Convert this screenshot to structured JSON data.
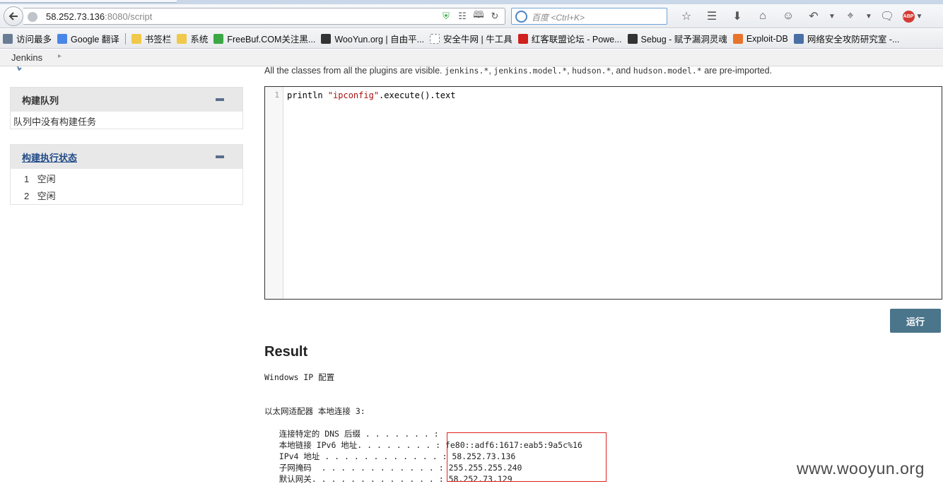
{
  "browser": {
    "url_host": "58.252.73.136",
    "url_path": ":8080/script",
    "search_placeholder": "百度 <Ctrl+K>",
    "abp_label": "ABP",
    "bookmarks": [
      {
        "label": "访问最多",
        "icon": "gear-icon",
        "color": "#6a7c94"
      },
      {
        "label": "Google 翻译",
        "icon": "google-translate-icon",
        "color": "#4a86e8"
      },
      {
        "label": "书签栏",
        "icon": "folder-icon",
        "color": "#f0c94b"
      },
      {
        "label": "系统",
        "icon": "folder-icon",
        "color": "#f0c94b"
      },
      {
        "label": "FreeBuf.COM关注黑...",
        "icon": "freebuf-icon",
        "color": "#3aa845"
      },
      {
        "label": "WooYun.org | 自由平...",
        "icon": "wooyun-icon",
        "color": "#333333"
      },
      {
        "label": "安全牛网 | 牛工具",
        "icon": "page-icon",
        "color": "#ffffff"
      },
      {
        "label": "红客联盟论坛 - Powe...",
        "icon": "hkm-icon",
        "color": "#d02020"
      },
      {
        "label": "Sebug - 赋予漏洞灵魂",
        "icon": "sebug-icon",
        "color": "#333333"
      },
      {
        "label": "Exploit-DB",
        "icon": "exploitdb-icon",
        "color": "#e8732a"
      },
      {
        "label": "网络安全攻防研究室 -...",
        "icon": "shield-icon",
        "color": "#4a6fa5"
      }
    ]
  },
  "jenkins": {
    "breadcrumb": "Jenkins",
    "queue": {
      "title": "构建队列",
      "empty_text": "队列中没有构建任务"
    },
    "executors": {
      "title": "构建执行状态",
      "rows": [
        {
          "num": "1",
          "status": "空闲"
        },
        {
          "num": "2",
          "status": "空闲"
        }
      ]
    },
    "description": {
      "prefix": "All the classes from all the plugins are visible.",
      "pkg1": "jenkins.*",
      "pkg2": "jenkins.model.*",
      "pkg3": "hudson.*",
      "and": "and",
      "pkg4": "hudson.model.*",
      "suffix": "are pre-imported."
    },
    "editor": {
      "line_number": "1",
      "code_prefix": "println ",
      "code_string": "\"ipconfig\"",
      "code_suffix": ".execute().text"
    },
    "run_button": "运行",
    "result_title": "Result",
    "result_output": "Windows IP 配置\n\n\n以太网适配器 本地连接 3:\n\n   连接特定的 DNS 后缀 . . . . . . . :\n   本地链接 IPv6 地址. . . . . . . . : fe80::adf6:1617:eab5:9a5c%16\n   IPv4 地址 . . . . . . . . . . . . : 58.252.73.136\n   子网掩码  . . . . . . . . . . . . : 255.255.255.240\n   默认网关. . . . . . . . . . . . . : 58.252.73.129"
  },
  "watermark": "www.wooyun.org"
}
